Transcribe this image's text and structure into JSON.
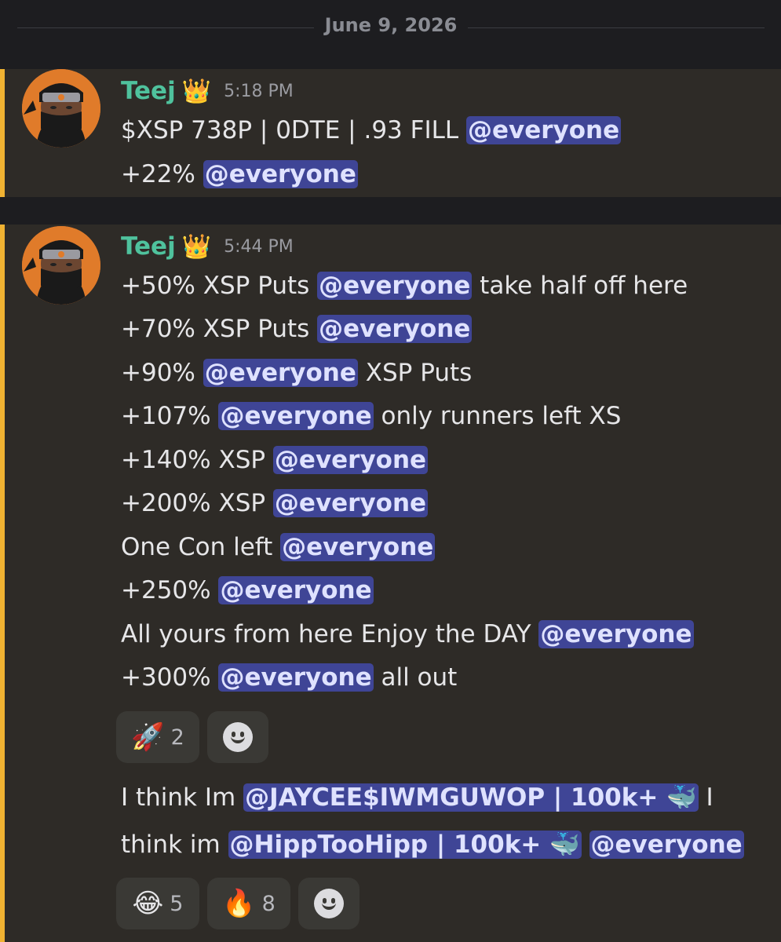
{
  "date_divider": "June 9, 2026",
  "messages": [
    {
      "author": "Teej",
      "badge": "👑",
      "time": "5:18 PM",
      "lines": [
        {
          "pre": "$XSP 738P | 0DTE | .93 FILL ",
          "mention": "@everyone",
          "post": ""
        },
        {
          "pre": "+22% ",
          "mention": "@everyone",
          "post": ""
        }
      ]
    },
    {
      "author": "Teej",
      "badge": "👑",
      "time": "5:44 PM",
      "lines": [
        {
          "pre": "+50% XSP Puts ",
          "mention": "@everyone",
          "post": " take half off here"
        },
        {
          "pre": "+70% XSP Puts ",
          "mention": "@everyone",
          "post": ""
        },
        {
          "pre": "+90% ",
          "mention": "@everyone",
          "post": " XSP Puts"
        },
        {
          "pre": "+107% ",
          "mention": "@everyone",
          "post": " only runners left XS"
        },
        {
          "pre": "+140% XSP ",
          "mention": "@everyone",
          "post": ""
        },
        {
          "pre": "+200% XSP ",
          "mention": "@everyone",
          "post": ""
        },
        {
          "pre": "One Con left ",
          "mention": "@everyone",
          "post": ""
        },
        {
          "pre": "+250% ",
          "mention": "@everyone",
          "post": ""
        },
        {
          "pre": "All yours from here Enjoy the DAY ",
          "mention": "@everyone",
          "post": ""
        },
        {
          "pre": "+300% ",
          "mention": "@everyone",
          "post": " all out"
        }
      ],
      "reactions": [
        {
          "emoji": "🚀",
          "count": "2"
        }
      ],
      "followup": {
        "line1_pre": "I think Im ",
        "line1_mention": "@JAYCEE$IWMGUWOP | 100k+ 🐳",
        "line1_post": " I",
        "line2_pre": "think im ",
        "line2_mention1": "@HippTooHipp | 100k+ 🐳",
        "line2_mid": " ",
        "line2_mention2": "@everyone"
      },
      "followup_reactions": [
        {
          "emoji": "😂",
          "count": "5"
        },
        {
          "emoji": "🔥",
          "count": "8"
        }
      ]
    }
  ],
  "colors": {
    "accent_bar": "#f0b232",
    "username": "#4fc29d",
    "mention_bg": "#3f4596"
  },
  "icons": [
    "add-reaction-icon",
    "avatar-ninja"
  ]
}
